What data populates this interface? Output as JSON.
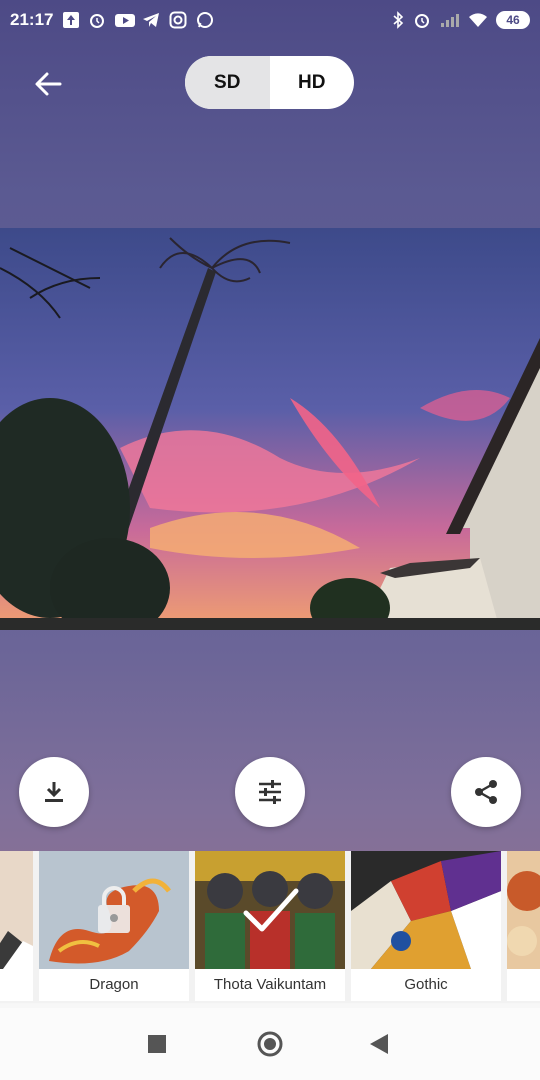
{
  "status_bar": {
    "time": "21:17",
    "battery": "46",
    "left_icons": [
      "upload-icon",
      "alarm-icon",
      "youtube-icon",
      "telegram-icon",
      "instagram-icon",
      "whatsapp-icon"
    ],
    "right_icons": [
      "bluetooth-icon",
      "alarm-icon",
      "signal-icon",
      "wifi-icon"
    ]
  },
  "header": {
    "quality_toggle": {
      "options": [
        "SD",
        "HD"
      ],
      "selected": "SD"
    }
  },
  "actions": {
    "download": "download-icon",
    "adjust": "sliders-icon",
    "share": "share-icon"
  },
  "styles": {
    "items": [
      {
        "label": "",
        "locked": false,
        "selected": false
      },
      {
        "label": "Dragon",
        "locked": true,
        "selected": false
      },
      {
        "label": "Thota Vaikuntam",
        "locked": false,
        "selected": true
      },
      {
        "label": "Gothic",
        "locked": false,
        "selected": false
      },
      {
        "label": "",
        "locked": false,
        "selected": false
      }
    ]
  },
  "colors": {
    "accent_bg": "#4d4a86",
    "toggle_selected": "#e4e4e6"
  }
}
